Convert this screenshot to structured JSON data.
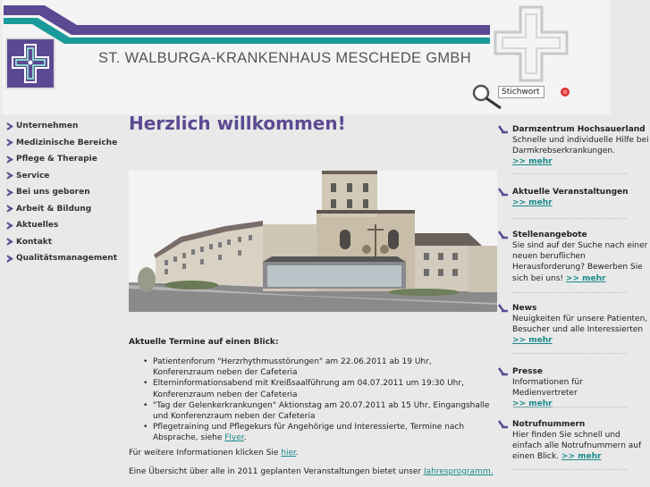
{
  "header": {
    "site_title": "ST. WALBURGA-KRANKENHAUS MESCHEDE GMBH",
    "search": {
      "value": "Stichwort",
      "go_label": "o"
    },
    "colors": {
      "purple": "#5b4a92",
      "teal": "#1a9a9a"
    }
  },
  "nav": {
    "items": [
      {
        "label": "Unternehmen"
      },
      {
        "label": "Medizinische Bereiche"
      },
      {
        "label": "Pflege & Therapie"
      },
      {
        "label": "Service"
      },
      {
        "label": "Bei uns geboren"
      },
      {
        "label": "Arbeit & Bildung"
      },
      {
        "label": "Aktuelles"
      },
      {
        "label": "Kontakt"
      },
      {
        "label": "Qualitätsmanagement"
      }
    ]
  },
  "main": {
    "welcome": "Herzlich willkommen!",
    "terms_heading": "Aktuelle Termine auf einen Blick:",
    "terms": [
      {
        "text": "Patientenforum \"Herzrhythmusstörungen\" am 22.06.2011 ab 19 Uhr, Konferenzraum neben der Cafeteria"
      },
      {
        "text": "Elterninformationsabend mit Kreißsaalführung am 04.07.2011 um 19:30 Uhr, Konferenzraum neben der Cafeteria"
      },
      {
        "text": "\"Tag der Gelenkerkrankungen\" Aktionstag am 20.07.2011 ab 15 Uhr, Eingangshalle und Konferenzraum neben der Cafeteria"
      },
      {
        "text": "Pflegetraining und Pflegekurs für Angehörige und Interessierte, Termine nach Absprache, siehe ",
        "link": "Flyer",
        "after": "."
      }
    ],
    "more_info": {
      "text": "Für weitere Informationen klicken Sie ",
      "link": "hier",
      "after": "."
    },
    "overview": {
      "text": "Eine Übersicht über alle in 2011 geplanten Veranstaltungen bietet unser ",
      "link": "Jahresprogramm."
    }
  },
  "sidebar": {
    "more_label": ">> mehr",
    "boxes": [
      {
        "title": "Darmzentrum Hochsauerland",
        "text": "Schnelle und individuelle Hilfe bei Darmkrebserkrankungen."
      },
      {
        "title": "Aktuelle Veranstaltungen",
        "text": ""
      },
      {
        "title": "Stellenangebote",
        "text": "Sie sind auf der Suche nach einer neuen beruflichen Herausforderung? Bewerben Sie sich bei uns!"
      },
      {
        "title": "News",
        "text": "Neuigkeiten für unsere Patienten, Besucher und alle Interessierten"
      },
      {
        "title": "Presse",
        "text": "Informationen für Medienvertreter"
      },
      {
        "title": "Notrufnummern",
        "text": "Hier finden Sie schnell und einfach alle Notrufnummern auf einen Blick."
      }
    ]
  }
}
